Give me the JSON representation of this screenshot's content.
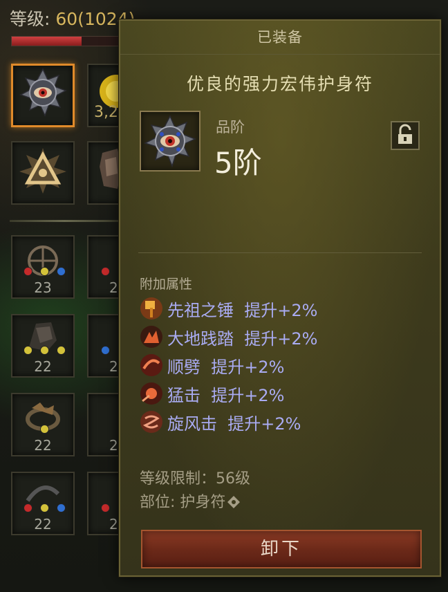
{
  "status": {
    "level_label": "等级: ",
    "level_value": "60(1024)",
    "xp_progress": 0.63
  },
  "inventory": {
    "partial_value": "3,2",
    "slot_counts": [
      "23",
      "2",
      "22",
      "2",
      "22",
      "2",
      "22",
      "2"
    ]
  },
  "tooltip": {
    "header": "已装备",
    "item_name": "优良的强力宏伟护身符",
    "rank_label": "品阶",
    "rank_value": "5阶",
    "attributes_title": "附加属性",
    "attributes": [
      {
        "text": "先祖之锤  提升+2%",
        "icon": "ancestral-hammer-icon"
      },
      {
        "text": "大地践踏  提升+2%",
        "icon": "ground-stomp-icon"
      },
      {
        "text": "顺劈  提升+2%",
        "icon": "cleave-icon"
      },
      {
        "text": "猛击  提升+2%",
        "icon": "bash-icon"
      },
      {
        "text": "旋风击  提升+2%",
        "icon": "whirlwind-icon"
      }
    ],
    "level_requirement": "等级限制：56级",
    "slot_label": "部位: 护身符",
    "unequip_label": "卸下"
  },
  "colors": {
    "attribute_text": "#a9abf2",
    "selected_border": "#e08a2a",
    "button_bg": "#6a2818"
  }
}
